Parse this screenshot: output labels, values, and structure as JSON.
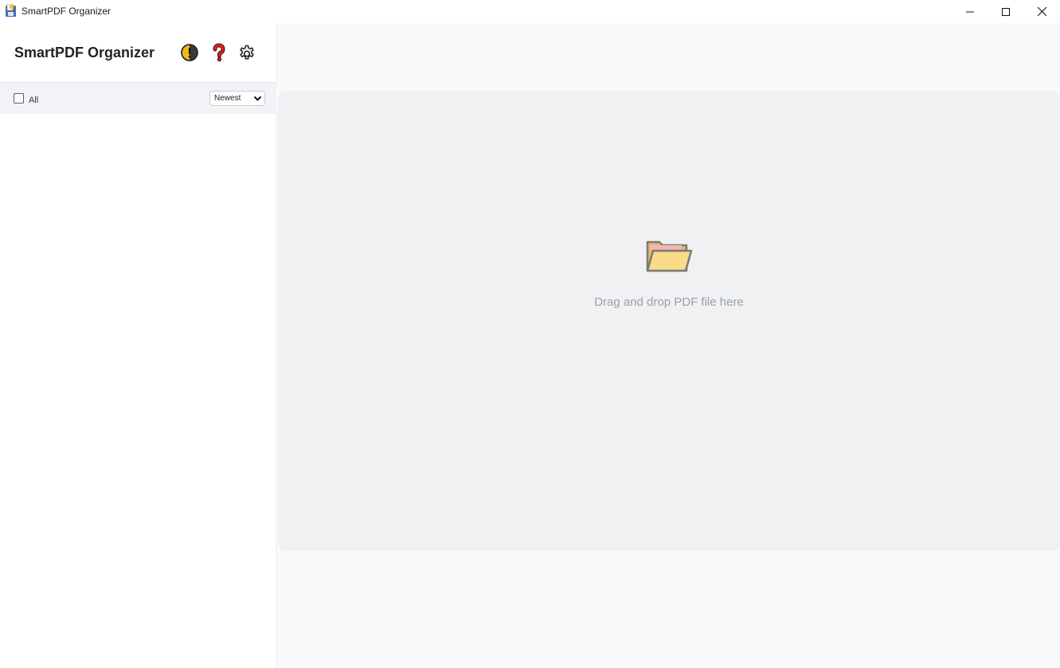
{
  "window": {
    "title": "SmartPDF Organizer",
    "controls": [
      "minimize-icon",
      "maximize-icon",
      "close-icon"
    ]
  },
  "sidebar": {
    "app_title": "SmartPDF Organizer",
    "header_icons": [
      "theme-toggle-icon",
      "help-icon",
      "settings-icon"
    ],
    "filter": {
      "select_all_label": "All",
      "select_all_checked": false,
      "sort_selected": "Newest"
    },
    "items": []
  },
  "main": {
    "dropzone_text": "Drag and drop PDF file here",
    "dropzone_icon": "open-folder-icon"
  },
  "colors": {
    "help_red": "#e02020",
    "theme_yellow": "#f5b916",
    "folder_yellow": "#f9dc8a",
    "dropzone_bg": "#f0f1f3"
  }
}
